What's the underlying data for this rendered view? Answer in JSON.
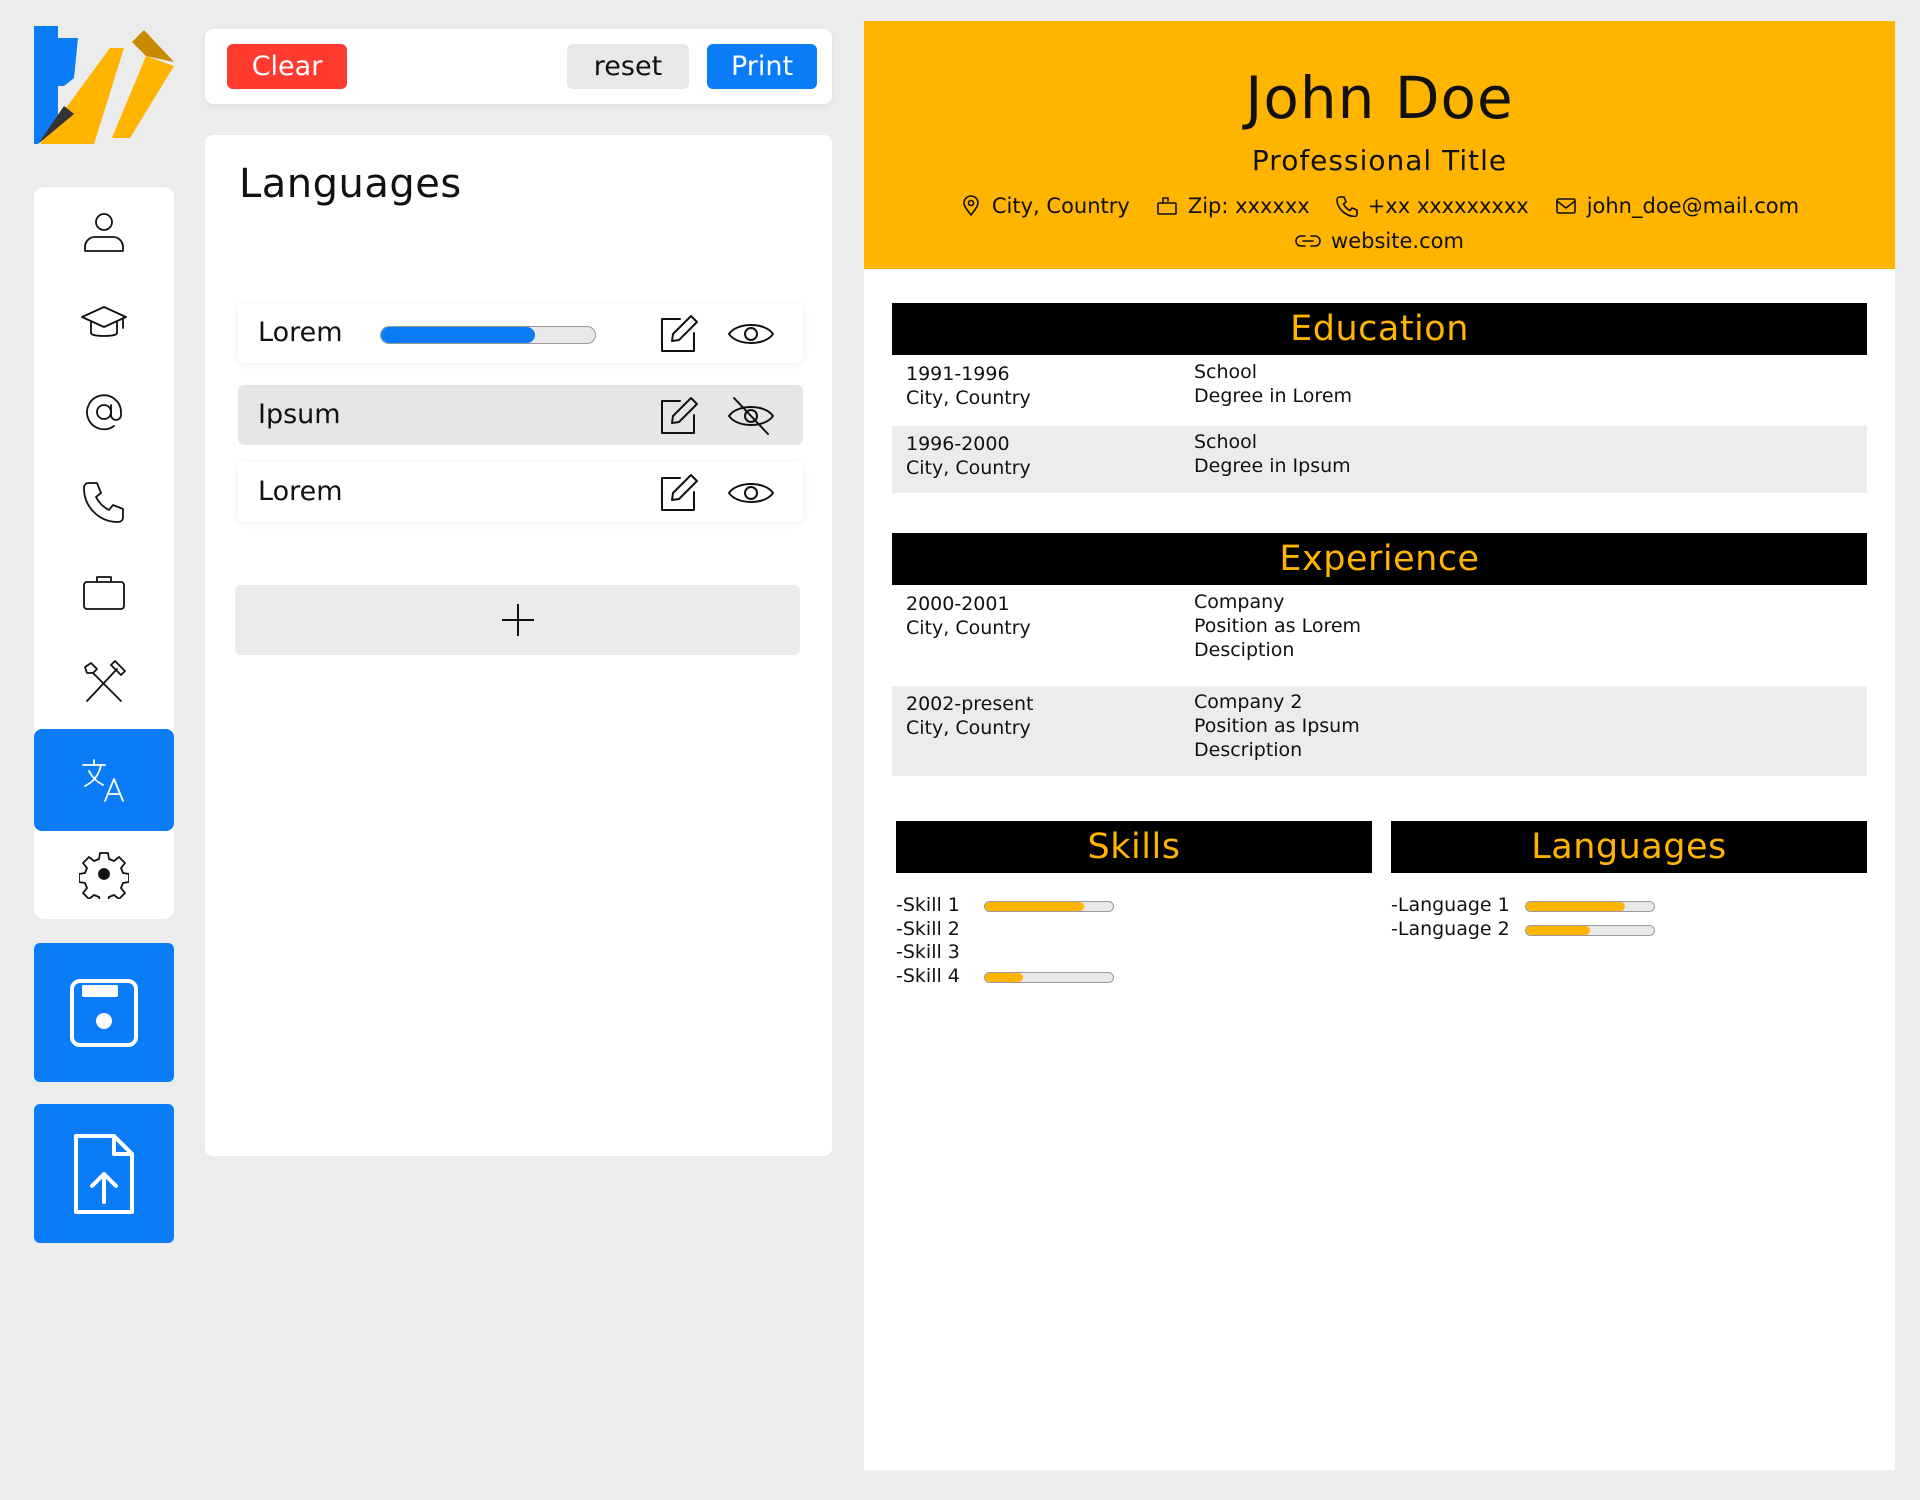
{
  "toolbar": {
    "clear_label": "Clear",
    "reset_label": "reset",
    "print_label": "Print"
  },
  "nav": {
    "items": [
      "personal",
      "education",
      "email",
      "phone",
      "experience",
      "skills",
      "languages",
      "settings"
    ],
    "active": "languages"
  },
  "editor": {
    "title": "Languages",
    "rows": [
      {
        "name": "Lorem",
        "level": 0.72,
        "visible": true,
        "show_bar": true
      },
      {
        "name": "Ipsum",
        "visible": false,
        "show_bar": false
      },
      {
        "name": "Lorem",
        "visible": true,
        "show_bar": false
      }
    ]
  },
  "resume": {
    "name": "John Doe",
    "title": "Professional Title",
    "contacts": {
      "location": "City, Country",
      "zip": "Zip: xxxxxx",
      "phone": "+xx xxxxxxxxx",
      "email": "john_doe@mail.com",
      "website": "website.com"
    },
    "education": {
      "heading": "Education",
      "entries": [
        {
          "years": "1991-1996",
          "place": "City, Country",
          "school": "School",
          "degree": "Degree in Lorem"
        },
        {
          "years": "1996-2000",
          "place": "City, Country",
          "school": "School",
          "degree": "Degree in Ipsum"
        }
      ]
    },
    "experience": {
      "heading": "Experience",
      "entries": [
        {
          "years": "2000-2001",
          "place": "City, Country",
          "company": "Company",
          "position": "Position as Lorem",
          "description": "Desciption"
        },
        {
          "years": "2002-present",
          "place": "City, Country",
          "company": "Company 2",
          "position": "Position as Ipsum",
          "description": "Description"
        }
      ]
    },
    "skills": {
      "heading": "Skills",
      "items": [
        {
          "name": "-Skill 1",
          "level": 0.77
        },
        {
          "name": "-Skill 2",
          "level": null
        },
        {
          "name": "-Skill 3",
          "level": null
        },
        {
          "name": "-Skill 4",
          "level": 0.3
        }
      ]
    },
    "languages": {
      "heading": "Languages",
      "items": [
        {
          "name": "-Language 1",
          "level": 0.77
        },
        {
          "name": "-Language 2",
          "level": 0.5
        }
      ]
    }
  },
  "colors": {
    "accent": "#0a7cf7",
    "danger": "#ff3b30",
    "resume_accent": "#ffb400",
    "section_bg": "#000000"
  }
}
